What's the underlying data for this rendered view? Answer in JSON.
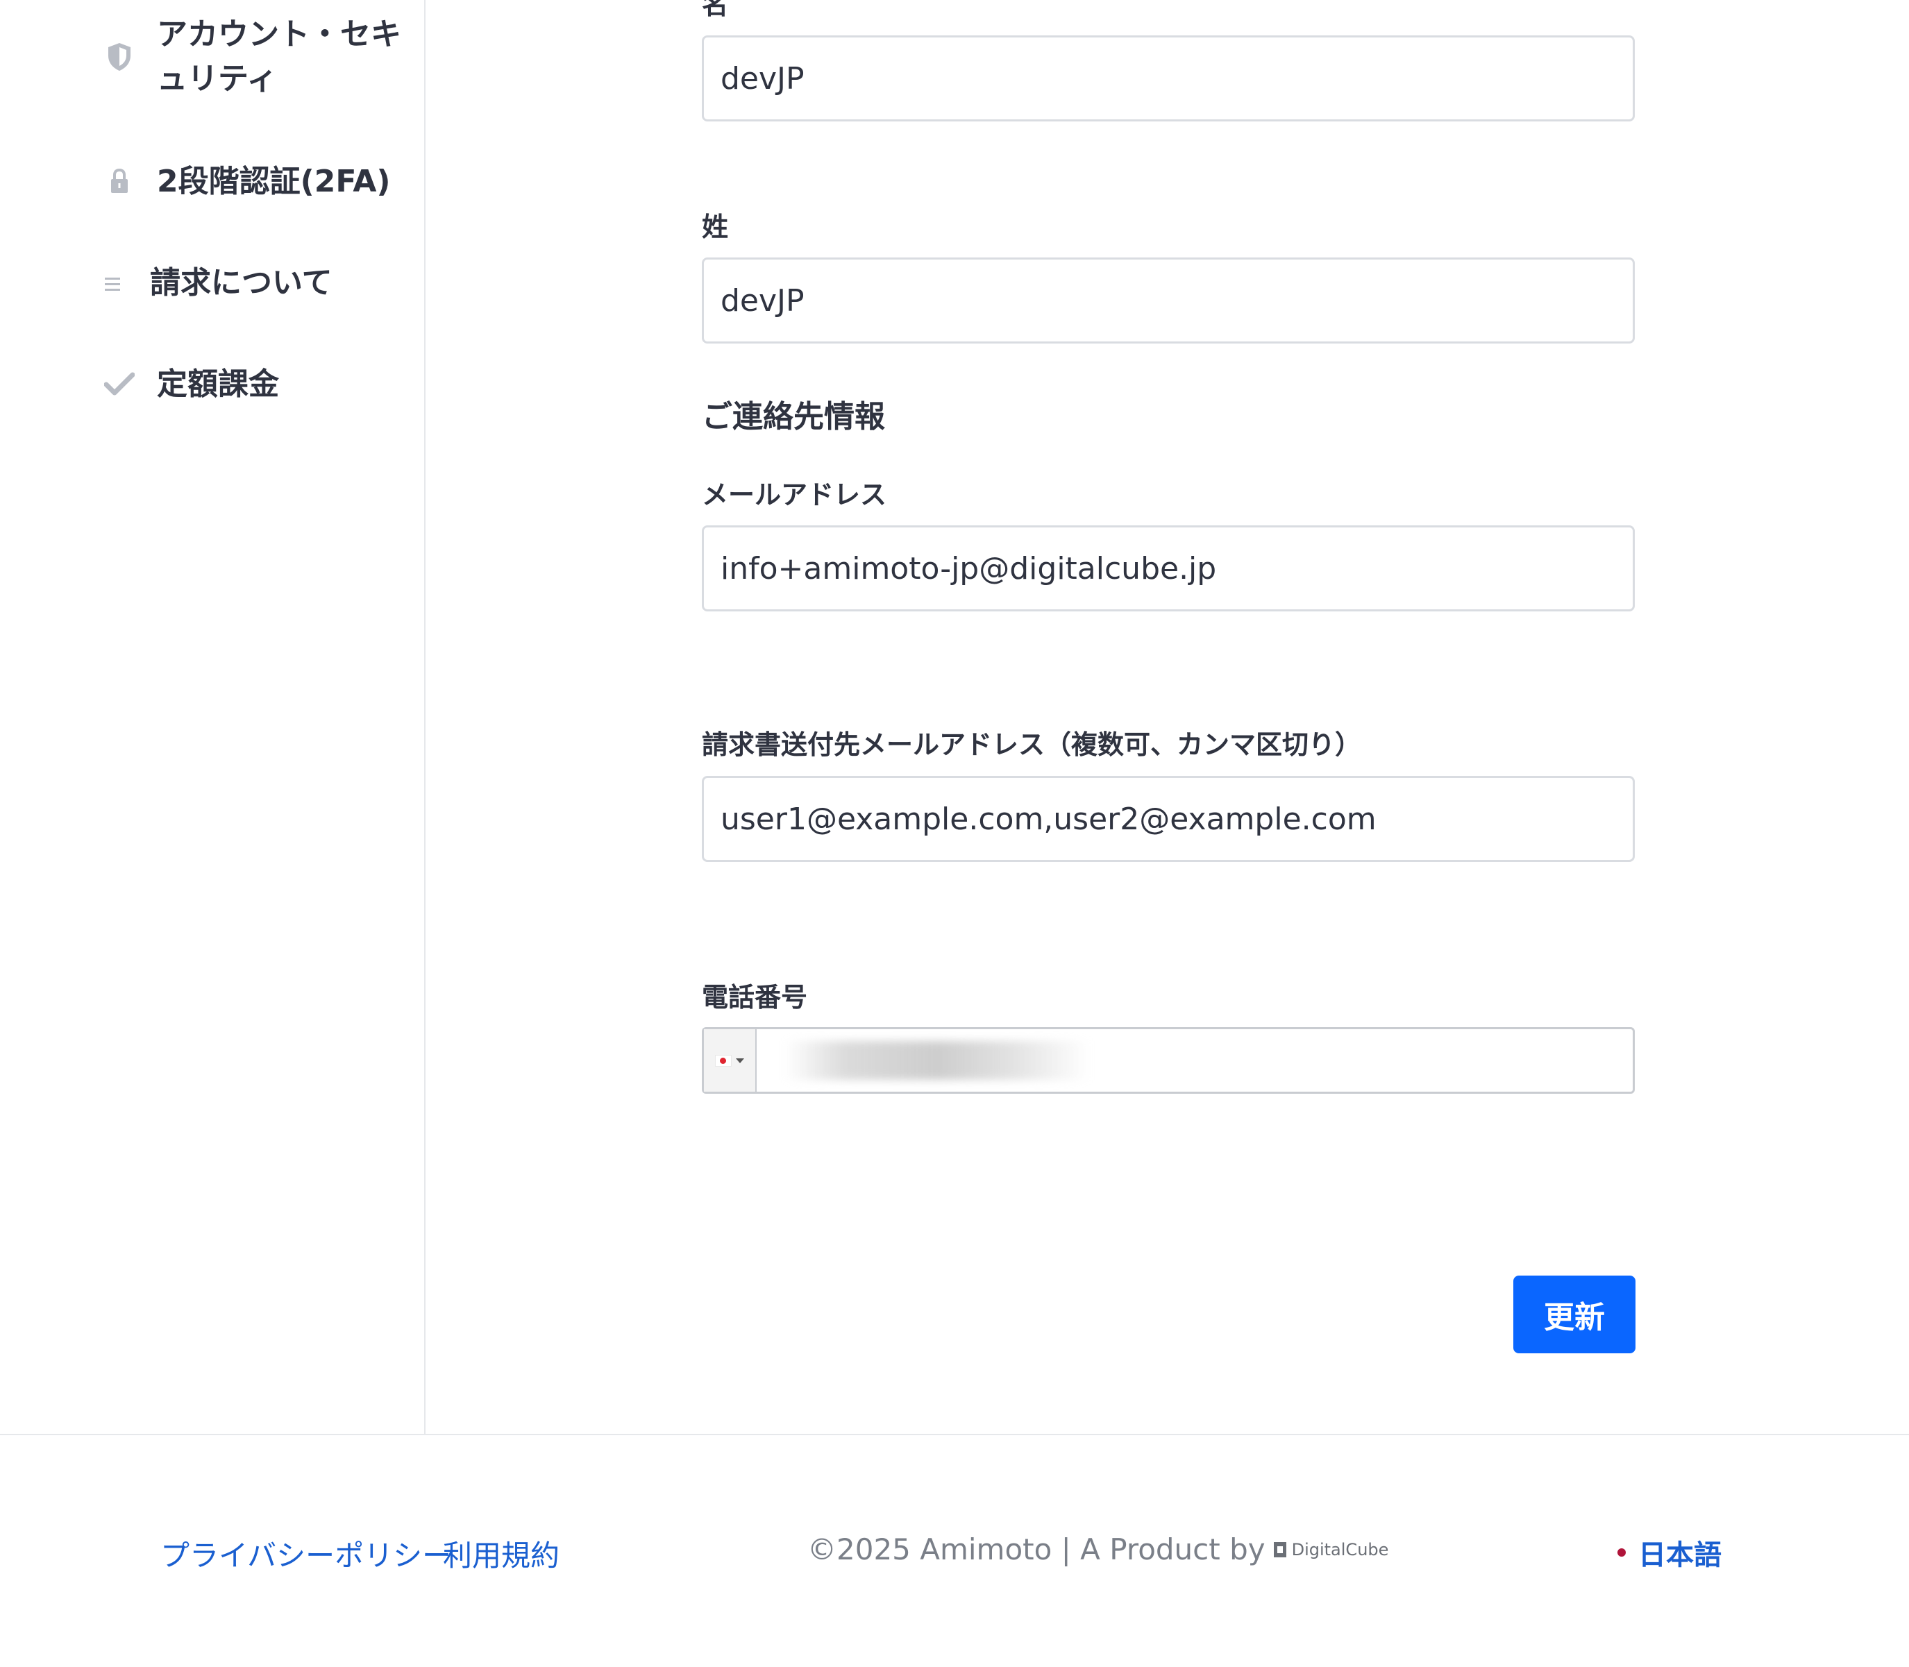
{
  "sidebar": {
    "items": [
      {
        "icon": "shield-icon",
        "label": "アカウント・セキ\nュリティ"
      },
      {
        "icon": "lock-icon",
        "label": "2段階認証(2FA)"
      },
      {
        "icon": "list-icon",
        "label": "請求について"
      },
      {
        "icon": "check-icon",
        "label": "定額課金"
      }
    ]
  },
  "form": {
    "first_name": {
      "label": "名",
      "value": "devJP"
    },
    "last_name": {
      "label": "姓",
      "value": "devJP"
    },
    "contact_heading": "ご連絡先情報",
    "email": {
      "label": "メールアドレス",
      "value": "info+amimoto-jp@digitalcube.jp"
    },
    "billing_email": {
      "label": "請求書送付先メールアドレス（複数可、カンマ区切り）",
      "value": "user1@example.com,user2@example.com"
    },
    "phone": {
      "label": "電話番号",
      "country_flag": "JP",
      "value": ""
    },
    "submit_label": "更新"
  },
  "footer": {
    "privacy_label": "プライバシーポリシー",
    "terms_label": "利用規約",
    "copyright": "©2025 Amimoto | A Product by",
    "brand_logo": "DigitalCube",
    "language": "日本語"
  },
  "colors": {
    "primary": "#0a66ff",
    "link": "#1a5fd0",
    "text": "#2f3340"
  }
}
